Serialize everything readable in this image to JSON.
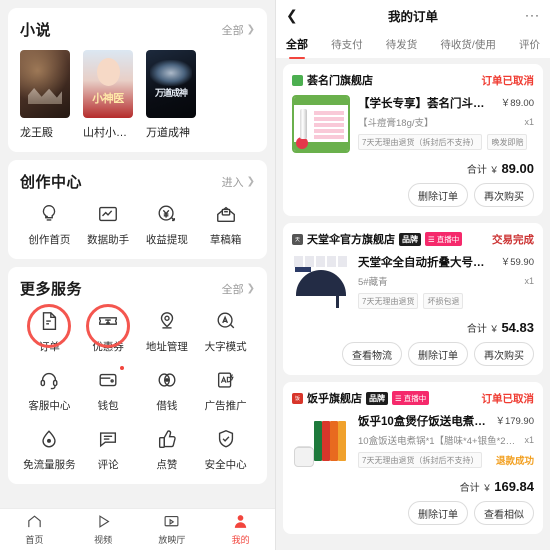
{
  "left": {
    "novel_section": {
      "title": "小说",
      "more_label": "全部",
      "items": [
        {
          "name": "龙王殿"
        },
        {
          "name": "山村小…"
        },
        {
          "name": "万道成神"
        }
      ]
    },
    "creation_section": {
      "title": "创作中心",
      "more_label": "进入",
      "items": [
        {
          "label": "创作首页",
          "icon": "lightbulb-icon"
        },
        {
          "label": "数据助手",
          "icon": "chart-icon"
        },
        {
          "label": "收益提现",
          "icon": "yuan-circle-icon"
        },
        {
          "label": "草稿箱",
          "icon": "drafts-icon"
        }
      ]
    },
    "services_section": {
      "title": "更多服务",
      "more_label": "全部",
      "items": [
        {
          "label": "订单",
          "icon": "document-icon",
          "highlighted": true
        },
        {
          "label": "优惠券",
          "icon": "ticket-icon",
          "highlighted": true
        },
        {
          "label": "地址管理",
          "icon": "location-pin-icon"
        },
        {
          "label": "大字模式",
          "icon": "letter-a-circle-icon"
        },
        {
          "label": "客服中心",
          "icon": "headset-icon"
        },
        {
          "label": "钱包",
          "icon": "wallet-icon",
          "badge": true
        },
        {
          "label": "借钱",
          "icon": "coins-icon"
        },
        {
          "label": "广告推广",
          "icon": "ad-icon"
        },
        {
          "label": "免流量服务",
          "icon": "droplet-icon"
        },
        {
          "label": "评论",
          "icon": "comment-icon"
        },
        {
          "label": "点赞",
          "icon": "thumbs-up-icon"
        },
        {
          "label": "安全中心",
          "icon": "shield-check-icon"
        }
      ]
    },
    "tabbar": {
      "items": [
        {
          "label": "首页",
          "icon": "home-icon",
          "active": false
        },
        {
          "label": "视频",
          "icon": "play-triangle-icon",
          "active": false
        },
        {
          "label": "放映厅",
          "icon": "screen-icon",
          "active": false
        },
        {
          "label": "我的",
          "icon": "person-icon",
          "active": true
        }
      ],
      "active_color": "#f2453d"
    }
  },
  "right": {
    "navbar": {
      "back_icon": "chevron-left-icon",
      "title": "我的订单",
      "menu_icon": "more-dots-icon"
    },
    "tabs": [
      {
        "label": "全部",
        "active": true
      },
      {
        "label": "待支付",
        "active": false
      },
      {
        "label": "待发货",
        "active": false
      },
      {
        "label": "待收货/使用",
        "active": false
      },
      {
        "label": "评价",
        "active": false
      }
    ],
    "orders": [
      {
        "shop": "荟名门旗舰店",
        "shop_avatar": "green",
        "badges": [],
        "status": "订单已取消",
        "status_color": "#ef3c32",
        "thumb": "acne-cream",
        "title": "【学长专享】荟名门斗痘…",
        "price": "￥89.00",
        "spec": "【斗痘膏18g/支】",
        "qty": "x1",
        "tags": [
          "7天无理由退货（拆封后不支持）",
          "晚发即赔"
        ],
        "refund_note": "",
        "total_label": "合计",
        "total_yen": "￥",
        "total": "89.00",
        "buttons": [
          "删除订单",
          "再次购买"
        ]
      },
      {
        "shop": "天堂伞官方旗舰店",
        "shop_avatar": "dark",
        "badges": [
          "品牌",
          "直播中"
        ],
        "status": "交易完成",
        "status_color": "#cc3333",
        "thumb": "umbrella",
        "title": "天堂伞全自动折叠大号纯…",
        "price": "￥59.90",
        "spec": "5#藏青",
        "qty": "x1",
        "tags": [
          "7天无理由退货",
          "坏损包退"
        ],
        "refund_note": "",
        "total_label": "合计",
        "total_yen": "￥",
        "total": "54.83",
        "buttons": [
          "查看物流",
          "删除订单",
          "再次购买"
        ]
      },
      {
        "shop": "饭乎旗舰店",
        "shop_avatar": "red",
        "badges": [
          "品牌",
          "直播中"
        ],
        "status": "订单已取消",
        "status_color": "#ef3c32",
        "thumb": "rice-box",
        "title": "饭乎10盒煲仔饭送电煮…",
        "price": "￥179.90",
        "spec": "10盒饭送电煮锅*1【腊味*4+银鱼*2+烟…",
        "qty": "x1",
        "tags": [
          "7天无理由退货（拆封后不支持）"
        ],
        "refund_note": "退款成功",
        "total_label": "合计",
        "total_yen": "￥",
        "total": "169.84",
        "buttons": [
          "删除订单",
          "查看相似"
        ]
      }
    ]
  }
}
